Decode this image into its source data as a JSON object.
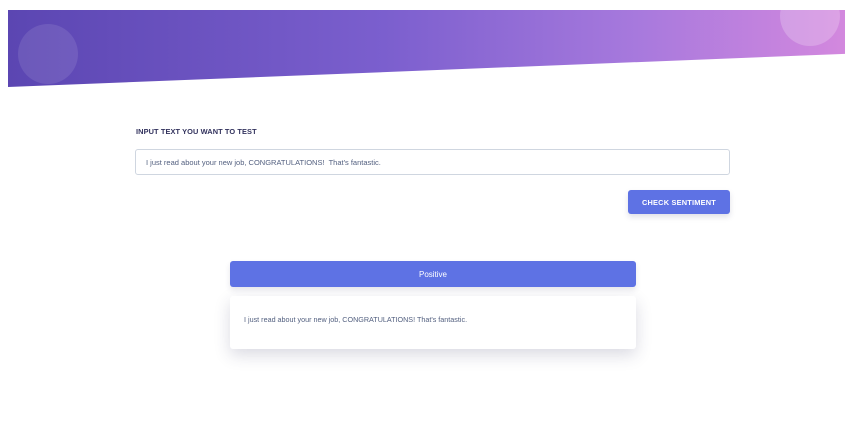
{
  "form": {
    "label": "INPUT TEXT YOU WANT TO TEST",
    "input_value": "I just read about your new job, CONGRATULATIONS!  That's fantastic.",
    "button_label": "CHECK SENTIMENT"
  },
  "result": {
    "sentiment": "Positive",
    "text": "I just read about your new job, CONGRATULATIONS! That's fantastic."
  },
  "colors": {
    "accent": "#5e72e4",
    "header_gradient_start": "#5b46b2",
    "header_gradient_end": "#d388de"
  }
}
